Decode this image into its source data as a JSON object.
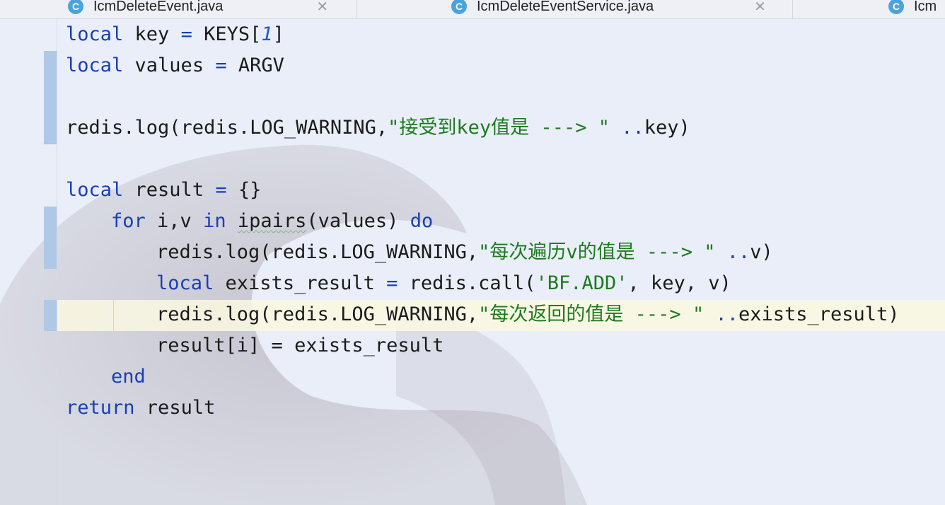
{
  "tabs": [
    {
      "label": "IcmDeleteEvent.java",
      "icon": "class-icon"
    },
    {
      "label": "IcmDeleteEventService.java",
      "icon": "class-icon"
    },
    {
      "label": "Icm",
      "icon": "class-icon"
    }
  ],
  "code": {
    "line1": {
      "kw": "local",
      "name": " key ",
      "op": "=",
      "rest": " KEYS[",
      "num": "1",
      "end": "]"
    },
    "line2": {
      "kw": "local",
      "name": " values ",
      "op": "=",
      "rest": " ARGV"
    },
    "line4": {
      "pre": "redis.log(redis.LOG_WARNING,",
      "str": "\"接受到key值是 ---> \"",
      "op": " ..",
      "rest": "key)"
    },
    "line6": {
      "kw": "local",
      "name": " result ",
      "op": "=",
      "rest": " {}"
    },
    "line7": {
      "kw1": "for",
      "mid": " i,v ",
      "kw2": "in",
      "sq": "ipairs",
      "rest": "(values) ",
      "kw3": "do"
    },
    "line8": {
      "pre": "redis.log(redis.LOG_WARNING,",
      "str": "\"每次遍历v的值是 ---> \"",
      "op": " ..",
      "rest": "v)"
    },
    "line9": {
      "kw": "local",
      "name": " exists_result ",
      "op": "=",
      "pre": " redis.call(",
      "str": "'BF.ADD'",
      "rest": ", key, v)"
    },
    "line10": {
      "pre": "redis.log(redis.LOG_WARNING,",
      "str": "\"每次返回的值是 ---> \"",
      "op": " ..",
      "rest": "exists_result)"
    },
    "line11": {
      "text": "result[i] = exists_result"
    },
    "line12": {
      "kw": "end"
    },
    "line13": {
      "kw": "return",
      "rest": " result"
    }
  },
  "colors": {
    "keyword": "#1a3eb5",
    "string": "#1e7a1e",
    "number": "#1e56d6",
    "change_marker": "#aec8e6",
    "current_line": "#faf8e1"
  }
}
